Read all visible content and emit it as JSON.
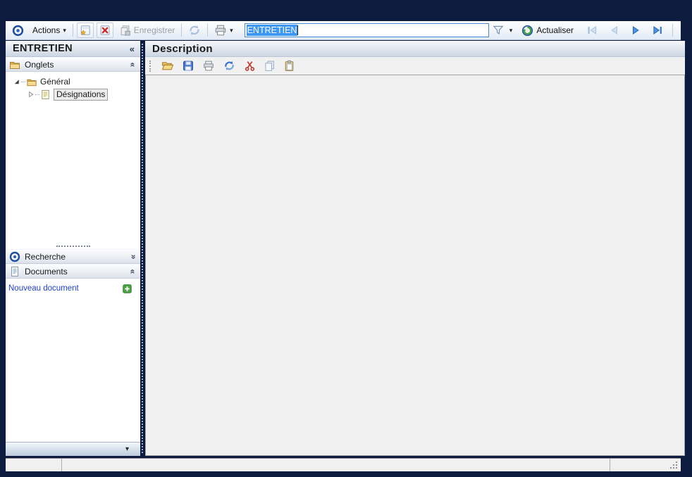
{
  "colors": {
    "app_background": "#0d1b3e",
    "selection_blue": "#3e97f2",
    "link_blue": "#2141cf",
    "nav_arrow_blue": "#4f94dc",
    "nav_arrow_disabled": "#cfe0f1"
  },
  "glyphs": {
    "collapse_left": "«",
    "double_chevron": "«",
    "dropdown": "▾"
  },
  "toolbar": {
    "actions_label": "Actions",
    "save_label": "Enregistrer",
    "name_input_value": "ENTRETIEN",
    "refresh_label": "Actualiser",
    "icons": [
      "target-icon",
      "new-item-icon",
      "delete-item-icon",
      "save-icon",
      "sync-icon",
      "print-icon",
      "filter-icon",
      "refresh-circle-icon",
      "first-record-icon",
      "previous-record-icon",
      "next-record-icon",
      "last-record-icon"
    ]
  },
  "sidebar": {
    "title": "ENTRETIEN",
    "groups": [
      {
        "label": "Onglets",
        "icon": "folder-icon",
        "chevron": "up"
      },
      {
        "label": "Recherche",
        "icon": "target-icon",
        "chevron": "down"
      },
      {
        "label": "Documents",
        "icon": "document-icon",
        "chevron": "up"
      }
    ],
    "tree": [
      {
        "label": "Général",
        "icon": "folder-icon",
        "level": 0,
        "expanded": true
      },
      {
        "label": "Désignations",
        "icon": "page-icon",
        "level": 1,
        "selected": true
      }
    ],
    "new_document_label": "Nouveau document"
  },
  "main": {
    "title": "Description",
    "toolbar_icons": [
      "open-folder-icon",
      "save-floppy-icon",
      "print-icon",
      "refresh-icon",
      "cut-icon",
      "copy-icon",
      "paste-icon"
    ]
  },
  "statusbar": {
    "left": "",
    "middle": "",
    "right": ""
  }
}
